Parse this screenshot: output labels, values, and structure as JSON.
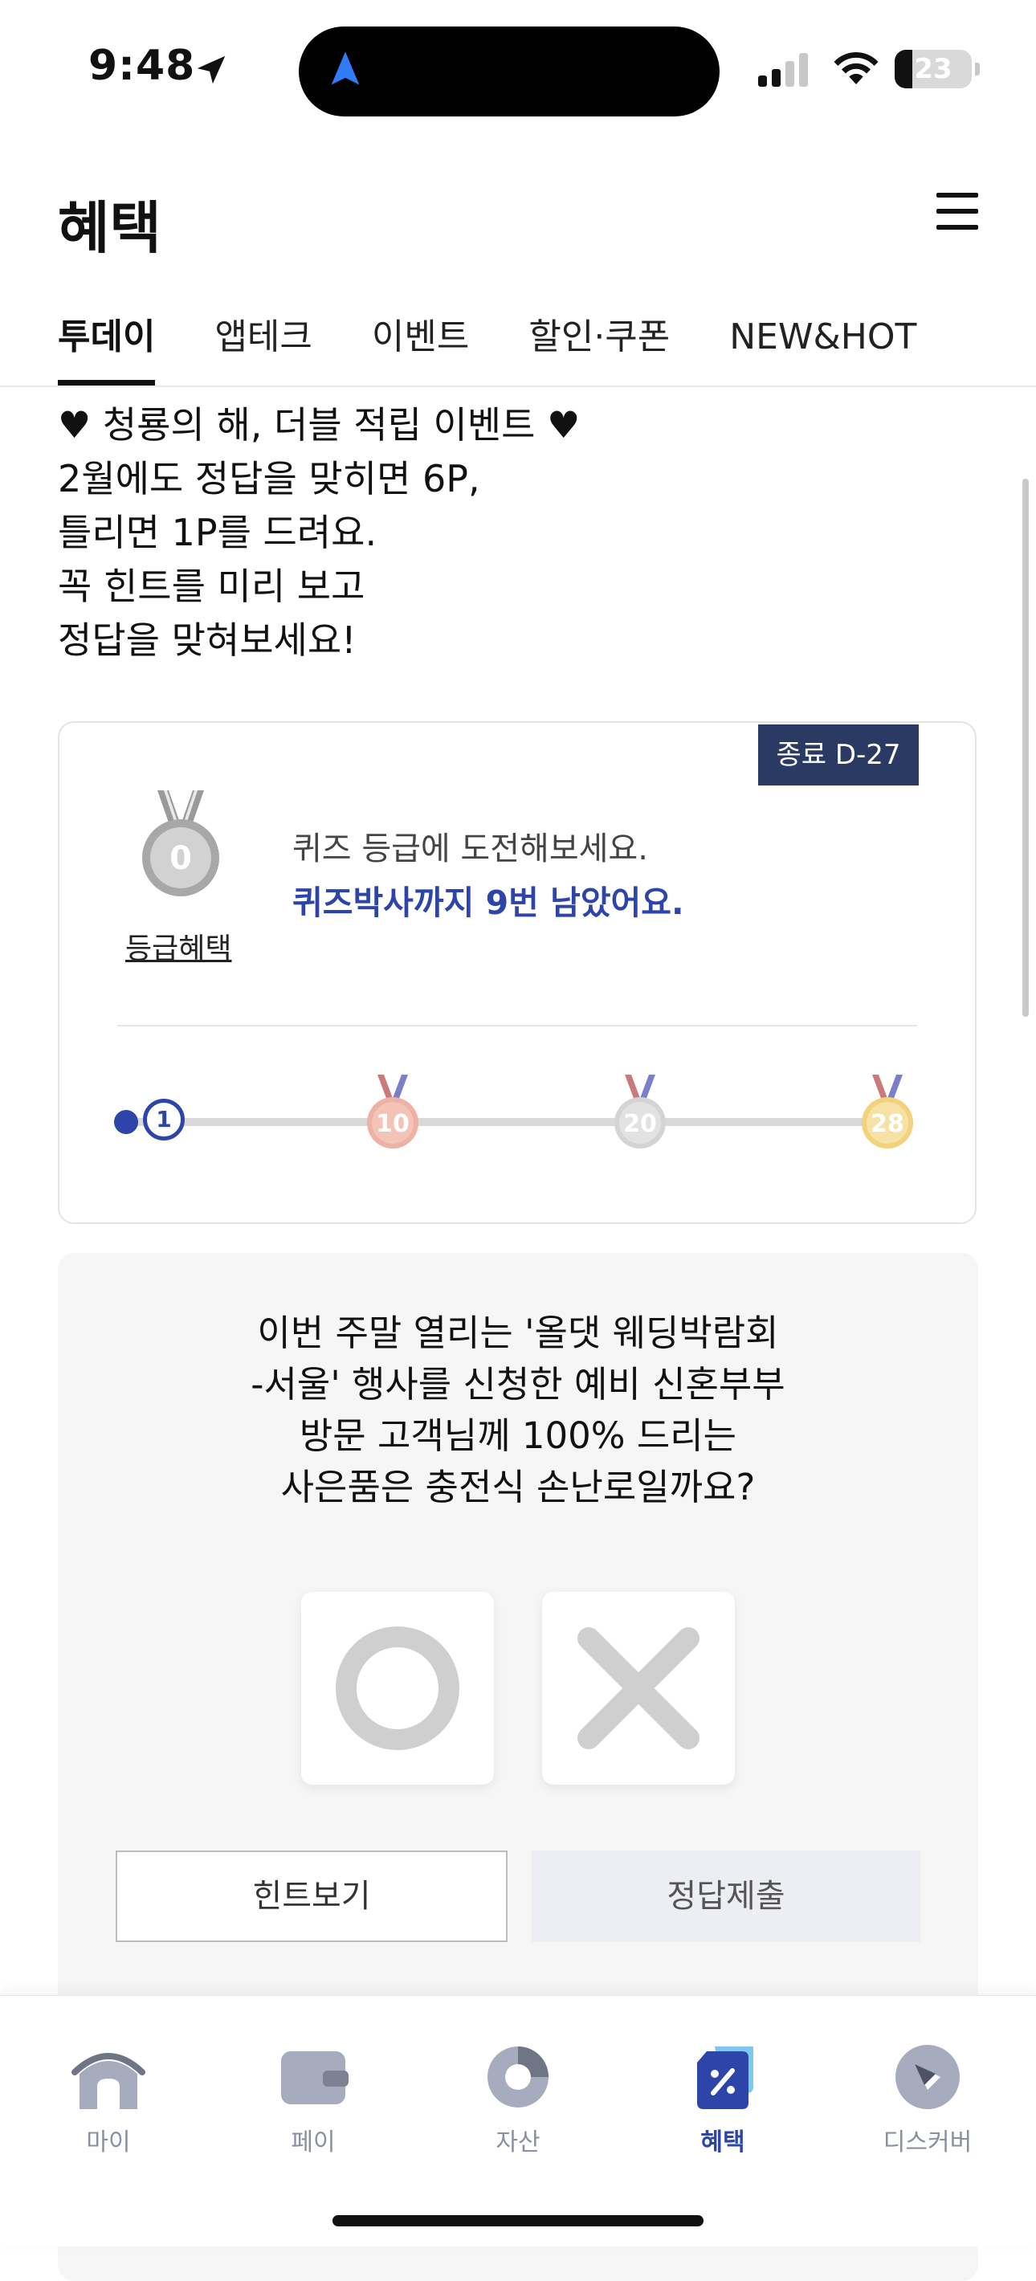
{
  "status_bar": {
    "time": "9:48",
    "battery": "23",
    "battery_level": 0.23
  },
  "header": {
    "title": "혜택"
  },
  "tabs": [
    {
      "label": "투데이",
      "active": true
    },
    {
      "label": "앱테크",
      "active": false
    },
    {
      "label": "이벤트",
      "active": false
    },
    {
      "label": "할인·쿠폰",
      "active": false
    },
    {
      "label": "NEW&HOT",
      "active": false
    }
  ],
  "intro": {
    "lines": [
      "♥ 청룡의 해, 더블 적립 이벤트 ♥",
      "2월에도 정답을 맞히면 6P,",
      "틀리면 1P를 드려요.",
      "꼭 힌트를 미리 보고",
      "정답을 맞혀보세요!"
    ]
  },
  "grade_card": {
    "dday_badge": "종료 D-27",
    "current_medal": "0",
    "grade_link": "등급혜택",
    "line1": "퀴즈 등급에 도전해보세요.",
    "line2": "퀴즈박사까지 9번 남았어요.",
    "current_step": "1",
    "milestones": [
      "10",
      "20",
      "28"
    ]
  },
  "quiz": {
    "question_lines": [
      "이번 주말 열리는 '올댓 웨딩박람회",
      "-서울' 행사를 신청한 예비 신혼부부",
      "방문 고객님께 100% 드리는",
      "사은품은 충전식 손난로일까요?"
    ],
    "hint_button": "힌트보기",
    "submit_button": "정답제출"
  },
  "bottom_nav": [
    {
      "label": "마이",
      "icon": "home-icon",
      "active": false
    },
    {
      "label": "페이",
      "icon": "wallet-icon",
      "active": false
    },
    {
      "label": "자산",
      "icon": "pie-chart-icon",
      "active": false
    },
    {
      "label": "혜택",
      "icon": "benefit-tag-icon",
      "active": true
    },
    {
      "label": "디스커버",
      "icon": "compass-icon",
      "active": false
    }
  ],
  "colors": {
    "accent": "#2d44a8",
    "badge": "#2a3a63",
    "bronze": "#e8a99a",
    "silver": "#cfcfcf",
    "gold": "#f2d27a"
  }
}
